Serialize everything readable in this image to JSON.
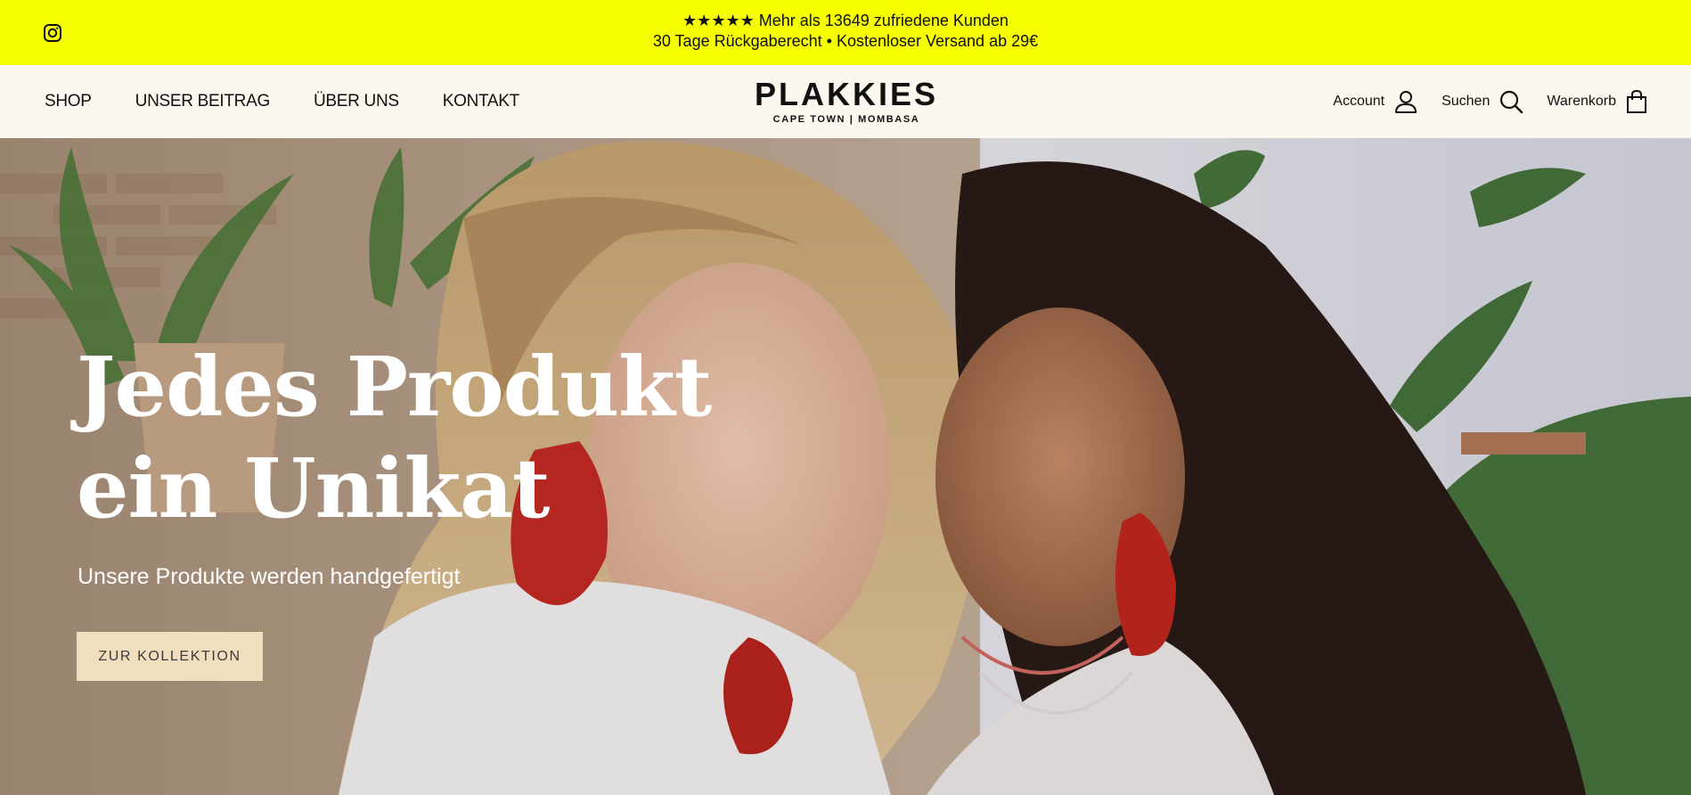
{
  "announcement": {
    "line1": "★★★★★ Mehr als 13649 zufriedene Kunden",
    "line2": "30 Tage Rückgaberecht • Kostenloser Versand ab 29€",
    "background": "#f6ff00",
    "social_icon": "instagram-icon"
  },
  "nav": {
    "items": [
      {
        "label": "SHOP"
      },
      {
        "label": "UNSER BEITRAG"
      },
      {
        "label": "ÜBER UNS"
      },
      {
        "label": "KONTAKT"
      }
    ]
  },
  "logo": {
    "brand": "PLAKKIES",
    "subtitle": "CAPE TOWN | MOMBASA"
  },
  "utility": {
    "account_label": "Account",
    "search_label": "Suchen",
    "cart_label": "Warenkorb",
    "icons": [
      "user-icon",
      "search-icon",
      "shopping-bag-icon"
    ]
  },
  "hero": {
    "headline_line1": "Jedes Produkt",
    "headline_line2": "ein Unikat",
    "subline": "Unsere Produkte werden handgefertigt",
    "cta_label": "ZUR KOLLEKTION",
    "cta_color": "#efdfbf"
  }
}
